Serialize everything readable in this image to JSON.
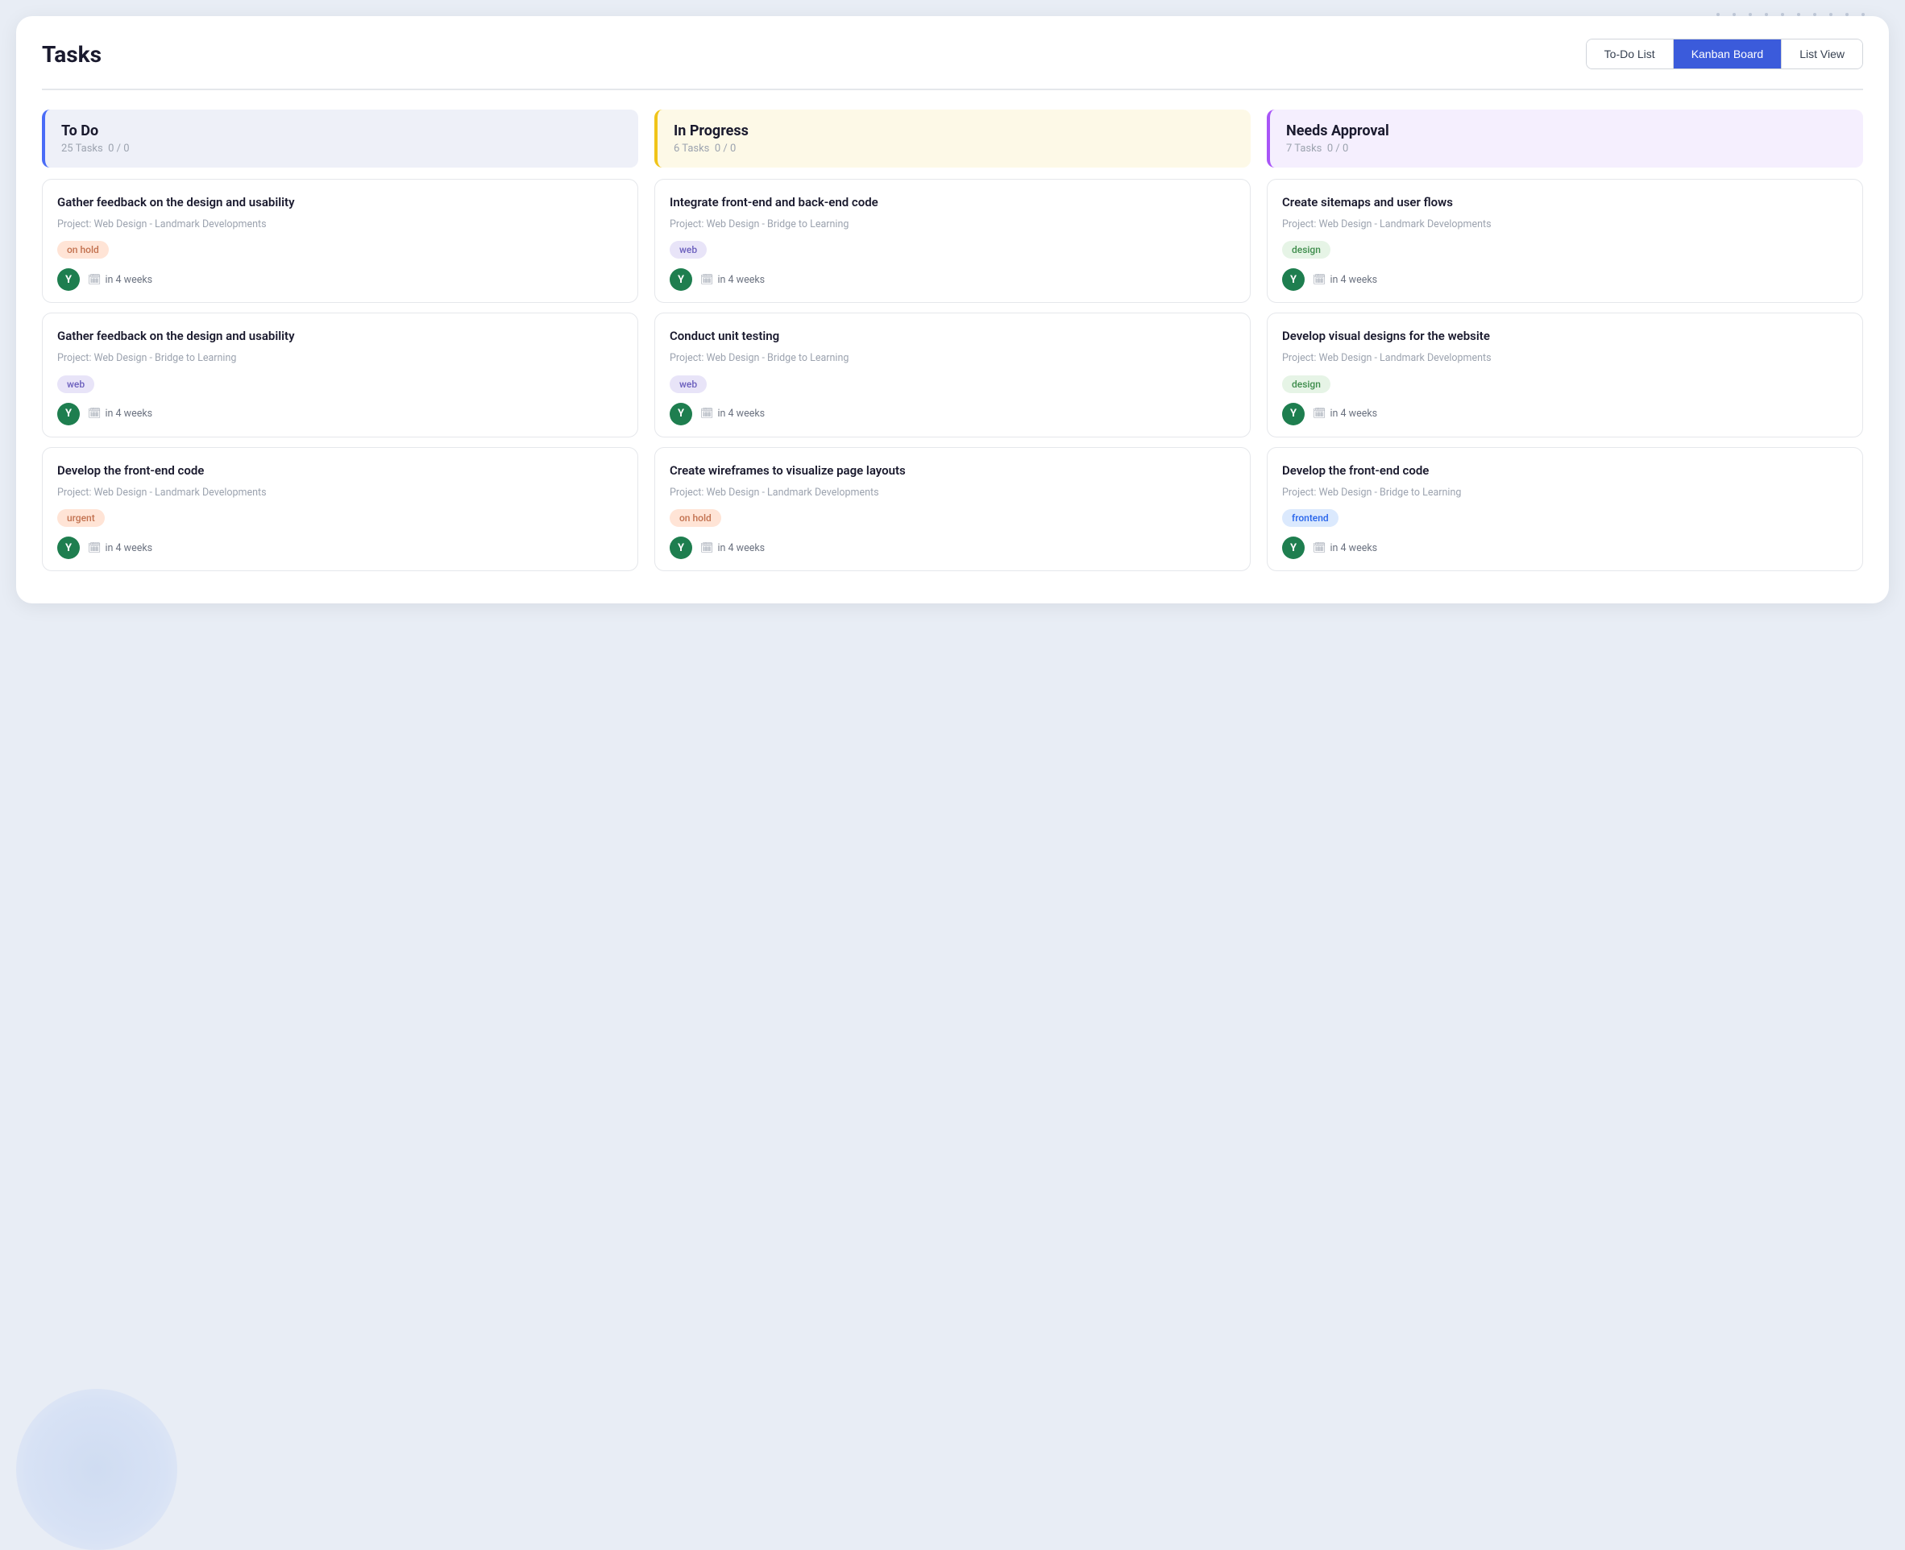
{
  "page": {
    "title": "Tasks"
  },
  "tabs": [
    {
      "id": "todo-list",
      "label": "To-Do List",
      "active": false
    },
    {
      "id": "kanban-board",
      "label": "Kanban Board",
      "active": true
    },
    {
      "id": "list-view",
      "label": "List View",
      "active": false
    }
  ],
  "columns": [
    {
      "id": "todo",
      "title": "To Do",
      "taskCount": "25 Tasks",
      "progress": "0 / 0",
      "colorClass": "todo",
      "tasks": [
        {
          "title": "Gather feedback on the design and usability",
          "project": "Project: Web Design - Landmark Developments",
          "tag": "on hold",
          "tagClass": "onhold",
          "assignee": "Y",
          "dueDate": "in 4 weeks"
        },
        {
          "title": "Gather feedback on the design and usability",
          "project": "Project: Web Design - Bridge to Learning",
          "tag": "web",
          "tagClass": "web",
          "assignee": "Y",
          "dueDate": "in 4 weeks"
        },
        {
          "title": "Develop the front-end code",
          "project": "Project: Web Design - Landmark Developments",
          "tag": "urgent",
          "tagClass": "urgent",
          "assignee": "Y",
          "dueDate": "in 4 weeks"
        }
      ]
    },
    {
      "id": "inprogress",
      "title": "In Progress",
      "taskCount": "6 Tasks",
      "progress": "0 / 0",
      "colorClass": "inprogress",
      "tasks": [
        {
          "title": "Integrate front-end and back-end code",
          "project": "Project: Web Design - Bridge to Learning",
          "tag": "web",
          "tagClass": "web",
          "assignee": "Y",
          "dueDate": "in 4 weeks"
        },
        {
          "title": "Conduct unit testing",
          "project": "Project: Web Design - Bridge to Learning",
          "tag": "web",
          "tagClass": "web",
          "assignee": "Y",
          "dueDate": "in 4 weeks"
        },
        {
          "title": "Create wireframes to visualize page layouts",
          "project": "Project: Web Design - Landmark Developments",
          "tag": "on hold",
          "tagClass": "onhold",
          "assignee": "Y",
          "dueDate": "in 4 weeks"
        }
      ]
    },
    {
      "id": "needsapproval",
      "title": "Needs Approval",
      "taskCount": "7 Tasks",
      "progress": "0 / 0",
      "colorClass": "needsapproval",
      "tasks": [
        {
          "title": "Create sitemaps and user flows",
          "project": "Project: Web Design - Landmark Developments",
          "tag": "design",
          "tagClass": "design",
          "assignee": "Y",
          "dueDate": "in 4 weeks"
        },
        {
          "title": "Develop visual designs for the website",
          "project": "Project: Web Design - Landmark Developments",
          "tag": "design",
          "tagClass": "design",
          "assignee": "Y",
          "dueDate": "in 4 weeks"
        },
        {
          "title": "Develop the front-end code",
          "project": "Project: Web Design - Bridge to Learning",
          "tag": "frontend",
          "tagClass": "frontend",
          "assignee": "Y",
          "dueDate": "in 4 weeks"
        }
      ]
    }
  ],
  "icons": {
    "calendar": "🗓",
    "calendarUnicode": "📅"
  }
}
